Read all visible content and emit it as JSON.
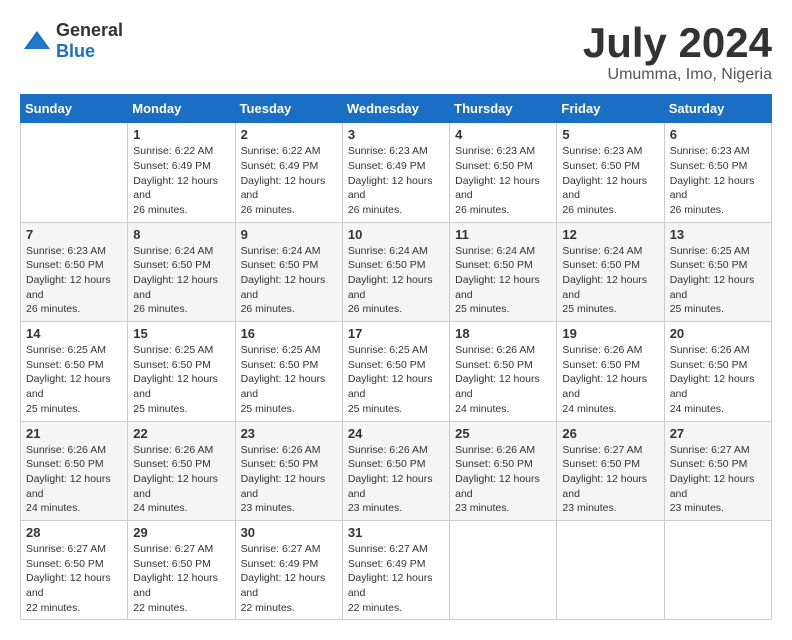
{
  "logo": {
    "general": "General",
    "blue": "Blue"
  },
  "title": {
    "month_year": "July 2024",
    "location": "Umumma, Imo, Nigeria"
  },
  "days_of_week": [
    "Sunday",
    "Monday",
    "Tuesday",
    "Wednesday",
    "Thursday",
    "Friday",
    "Saturday"
  ],
  "weeks": [
    [
      {
        "day": "",
        "sunrise": "",
        "sunset": "",
        "daylight": ""
      },
      {
        "day": "1",
        "sunrise": "Sunrise: 6:22 AM",
        "sunset": "Sunset: 6:49 PM",
        "daylight": "Daylight: 12 hours and 26 minutes."
      },
      {
        "day": "2",
        "sunrise": "Sunrise: 6:22 AM",
        "sunset": "Sunset: 6:49 PM",
        "daylight": "Daylight: 12 hours and 26 minutes."
      },
      {
        "day": "3",
        "sunrise": "Sunrise: 6:23 AM",
        "sunset": "Sunset: 6:49 PM",
        "daylight": "Daylight: 12 hours and 26 minutes."
      },
      {
        "day": "4",
        "sunrise": "Sunrise: 6:23 AM",
        "sunset": "Sunset: 6:50 PM",
        "daylight": "Daylight: 12 hours and 26 minutes."
      },
      {
        "day": "5",
        "sunrise": "Sunrise: 6:23 AM",
        "sunset": "Sunset: 6:50 PM",
        "daylight": "Daylight: 12 hours and 26 minutes."
      },
      {
        "day": "6",
        "sunrise": "Sunrise: 6:23 AM",
        "sunset": "Sunset: 6:50 PM",
        "daylight": "Daylight: 12 hours and 26 minutes."
      }
    ],
    [
      {
        "day": "7",
        "sunrise": "Sunrise: 6:23 AM",
        "sunset": "Sunset: 6:50 PM",
        "daylight": "Daylight: 12 hours and 26 minutes."
      },
      {
        "day": "8",
        "sunrise": "Sunrise: 6:24 AM",
        "sunset": "Sunset: 6:50 PM",
        "daylight": "Daylight: 12 hours and 26 minutes."
      },
      {
        "day": "9",
        "sunrise": "Sunrise: 6:24 AM",
        "sunset": "Sunset: 6:50 PM",
        "daylight": "Daylight: 12 hours and 26 minutes."
      },
      {
        "day": "10",
        "sunrise": "Sunrise: 6:24 AM",
        "sunset": "Sunset: 6:50 PM",
        "daylight": "Daylight: 12 hours and 26 minutes."
      },
      {
        "day": "11",
        "sunrise": "Sunrise: 6:24 AM",
        "sunset": "Sunset: 6:50 PM",
        "daylight": "Daylight: 12 hours and 25 minutes."
      },
      {
        "day": "12",
        "sunrise": "Sunrise: 6:24 AM",
        "sunset": "Sunset: 6:50 PM",
        "daylight": "Daylight: 12 hours and 25 minutes."
      },
      {
        "day": "13",
        "sunrise": "Sunrise: 6:25 AM",
        "sunset": "Sunset: 6:50 PM",
        "daylight": "Daylight: 12 hours and 25 minutes."
      }
    ],
    [
      {
        "day": "14",
        "sunrise": "Sunrise: 6:25 AM",
        "sunset": "Sunset: 6:50 PM",
        "daylight": "Daylight: 12 hours and 25 minutes."
      },
      {
        "day": "15",
        "sunrise": "Sunrise: 6:25 AM",
        "sunset": "Sunset: 6:50 PM",
        "daylight": "Daylight: 12 hours and 25 minutes."
      },
      {
        "day": "16",
        "sunrise": "Sunrise: 6:25 AM",
        "sunset": "Sunset: 6:50 PM",
        "daylight": "Daylight: 12 hours and 25 minutes."
      },
      {
        "day": "17",
        "sunrise": "Sunrise: 6:25 AM",
        "sunset": "Sunset: 6:50 PM",
        "daylight": "Daylight: 12 hours and 25 minutes."
      },
      {
        "day": "18",
        "sunrise": "Sunrise: 6:26 AM",
        "sunset": "Sunset: 6:50 PM",
        "daylight": "Daylight: 12 hours and 24 minutes."
      },
      {
        "day": "19",
        "sunrise": "Sunrise: 6:26 AM",
        "sunset": "Sunset: 6:50 PM",
        "daylight": "Daylight: 12 hours and 24 minutes."
      },
      {
        "day": "20",
        "sunrise": "Sunrise: 6:26 AM",
        "sunset": "Sunset: 6:50 PM",
        "daylight": "Daylight: 12 hours and 24 minutes."
      }
    ],
    [
      {
        "day": "21",
        "sunrise": "Sunrise: 6:26 AM",
        "sunset": "Sunset: 6:50 PM",
        "daylight": "Daylight: 12 hours and 24 minutes."
      },
      {
        "day": "22",
        "sunrise": "Sunrise: 6:26 AM",
        "sunset": "Sunset: 6:50 PM",
        "daylight": "Daylight: 12 hours and 24 minutes."
      },
      {
        "day": "23",
        "sunrise": "Sunrise: 6:26 AM",
        "sunset": "Sunset: 6:50 PM",
        "daylight": "Daylight: 12 hours and 23 minutes."
      },
      {
        "day": "24",
        "sunrise": "Sunrise: 6:26 AM",
        "sunset": "Sunset: 6:50 PM",
        "daylight": "Daylight: 12 hours and 23 minutes."
      },
      {
        "day": "25",
        "sunrise": "Sunrise: 6:26 AM",
        "sunset": "Sunset: 6:50 PM",
        "daylight": "Daylight: 12 hours and 23 minutes."
      },
      {
        "day": "26",
        "sunrise": "Sunrise: 6:27 AM",
        "sunset": "Sunset: 6:50 PM",
        "daylight": "Daylight: 12 hours and 23 minutes."
      },
      {
        "day": "27",
        "sunrise": "Sunrise: 6:27 AM",
        "sunset": "Sunset: 6:50 PM",
        "daylight": "Daylight: 12 hours and 23 minutes."
      }
    ],
    [
      {
        "day": "28",
        "sunrise": "Sunrise: 6:27 AM",
        "sunset": "Sunset: 6:50 PM",
        "daylight": "Daylight: 12 hours and 22 minutes."
      },
      {
        "day": "29",
        "sunrise": "Sunrise: 6:27 AM",
        "sunset": "Sunset: 6:50 PM",
        "daylight": "Daylight: 12 hours and 22 minutes."
      },
      {
        "day": "30",
        "sunrise": "Sunrise: 6:27 AM",
        "sunset": "Sunset: 6:49 PM",
        "daylight": "Daylight: 12 hours and 22 minutes."
      },
      {
        "day": "31",
        "sunrise": "Sunrise: 6:27 AM",
        "sunset": "Sunset: 6:49 PM",
        "daylight": "Daylight: 12 hours and 22 minutes."
      },
      {
        "day": "",
        "sunrise": "",
        "sunset": "",
        "daylight": ""
      },
      {
        "day": "",
        "sunrise": "",
        "sunset": "",
        "daylight": ""
      },
      {
        "day": "",
        "sunrise": "",
        "sunset": "",
        "daylight": ""
      }
    ]
  ]
}
